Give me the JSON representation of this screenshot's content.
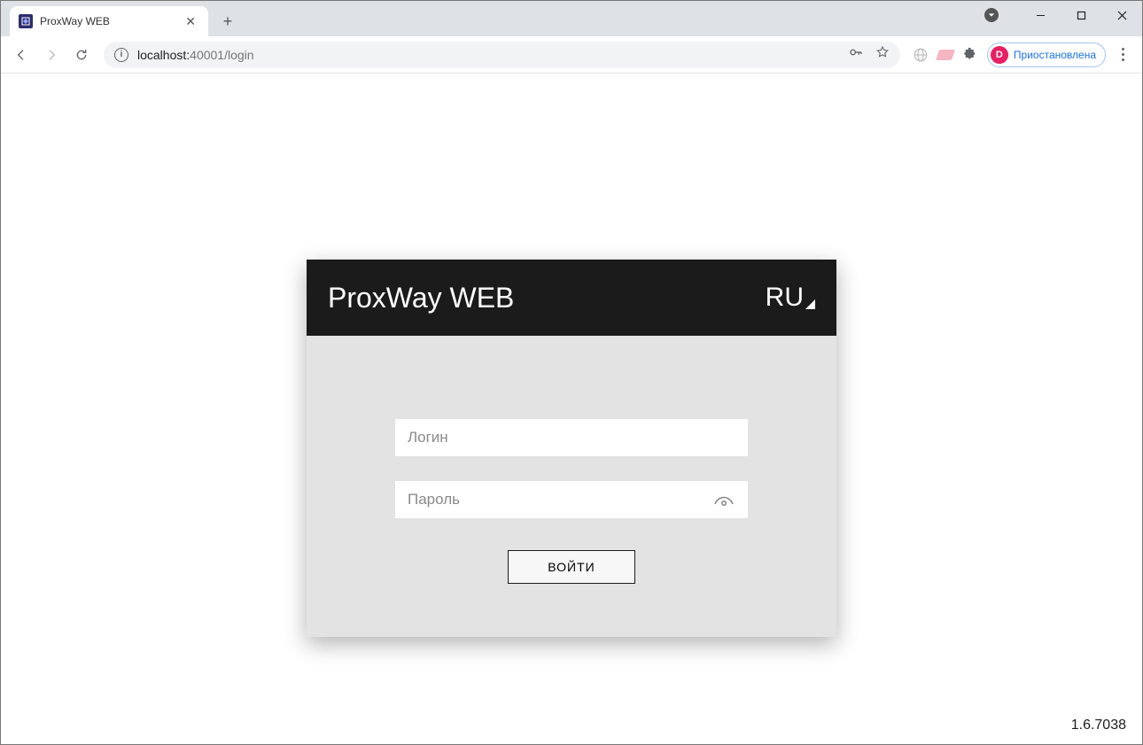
{
  "browser": {
    "tab_title": "ProxWay WEB",
    "url_host": "localhost:",
    "url_port_path": "40001/login",
    "profile_initial": "D",
    "profile_status": "Приостановлена"
  },
  "login": {
    "app_title": "ProxWay WEB",
    "language": "RU",
    "username_placeholder": "Логин",
    "password_placeholder": "Пароль",
    "submit_label": "ВОЙТИ"
  },
  "footer": {
    "version": "1.6.7038"
  }
}
